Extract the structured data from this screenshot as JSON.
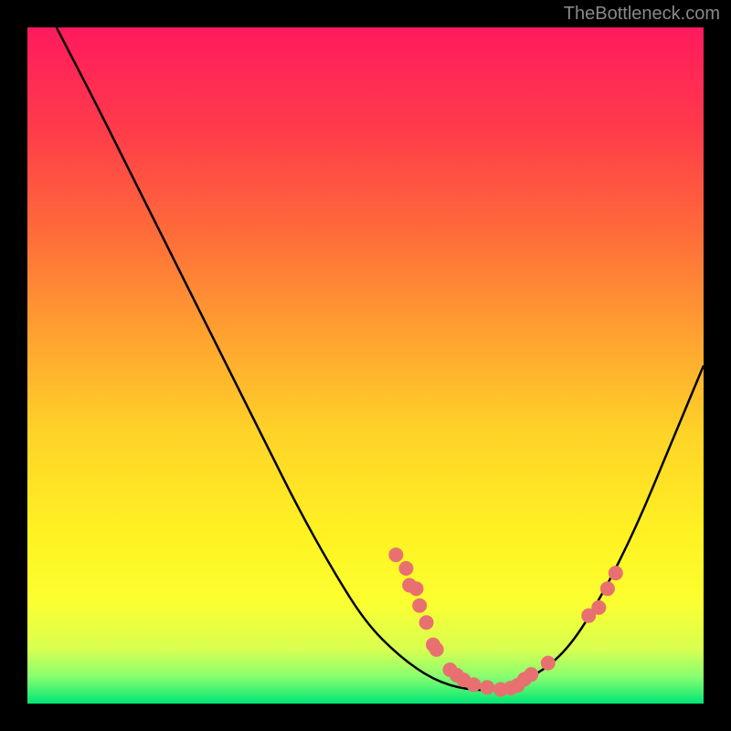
{
  "watermark": "TheBottleneck.com",
  "chart_data": {
    "type": "line",
    "title": "",
    "xlabel": "",
    "ylabel": "",
    "curve": {
      "description": "V-shaped bottleneck curve descending steeply then rising",
      "points_normalized": [
        [
          0.043,
          0.0
        ],
        [
          0.1,
          0.11
        ],
        [
          0.15,
          0.21
        ],
        [
          0.2,
          0.31
        ],
        [
          0.25,
          0.41
        ],
        [
          0.3,
          0.51
        ],
        [
          0.35,
          0.61
        ],
        [
          0.4,
          0.71
        ],
        [
          0.45,
          0.8
        ],
        [
          0.5,
          0.88
        ],
        [
          0.55,
          0.93
        ],
        [
          0.6,
          0.965
        ],
        [
          0.65,
          0.98
        ],
        [
          0.7,
          0.98
        ],
        [
          0.75,
          0.96
        ],
        [
          0.8,
          0.92
        ],
        [
          0.85,
          0.84
        ],
        [
          0.9,
          0.74
        ],
        [
          0.95,
          0.62
        ],
        [
          1.0,
          0.5
        ]
      ]
    },
    "scatter_points": {
      "description": "highlighted points near curve minimum region",
      "clusters": [
        {
          "x_norm": 0.545,
          "y_norm": 0.78
        },
        {
          "x_norm": 0.56,
          "y_norm": 0.8
        },
        {
          "x_norm": 0.565,
          "y_norm": 0.825
        },
        {
          "x_norm": 0.575,
          "y_norm": 0.83
        },
        {
          "x_norm": 0.58,
          "y_norm": 0.855
        },
        {
          "x_norm": 0.59,
          "y_norm": 0.88
        },
        {
          "x_norm": 0.6,
          "y_norm": 0.913
        },
        {
          "x_norm": 0.605,
          "y_norm": 0.92
        },
        {
          "x_norm": 0.625,
          "y_norm": 0.95
        },
        {
          "x_norm": 0.635,
          "y_norm": 0.958
        },
        {
          "x_norm": 0.645,
          "y_norm": 0.965
        },
        {
          "x_norm": 0.66,
          "y_norm": 0.972
        },
        {
          "x_norm": 0.68,
          "y_norm": 0.976
        },
        {
          "x_norm": 0.7,
          "y_norm": 0.979
        },
        {
          "x_norm": 0.715,
          "y_norm": 0.977
        },
        {
          "x_norm": 0.725,
          "y_norm": 0.973
        },
        {
          "x_norm": 0.735,
          "y_norm": 0.964
        },
        {
          "x_norm": 0.745,
          "y_norm": 0.957
        },
        {
          "x_norm": 0.77,
          "y_norm": 0.94
        },
        {
          "x_norm": 0.83,
          "y_norm": 0.87
        },
        {
          "x_norm": 0.845,
          "y_norm": 0.858
        },
        {
          "x_norm": 0.858,
          "y_norm": 0.83
        },
        {
          "x_norm": 0.87,
          "y_norm": 0.807
        }
      ]
    },
    "gradient_stops": [
      {
        "offset": 0.0,
        "color": "#ff1a5e"
      },
      {
        "offset": 0.15,
        "color": "#ff3b4a"
      },
      {
        "offset": 0.3,
        "color": "#ff6a3a"
      },
      {
        "offset": 0.45,
        "color": "#ffa030"
      },
      {
        "offset": 0.6,
        "color": "#ffd328"
      },
      {
        "offset": 0.75,
        "color": "#fff222"
      },
      {
        "offset": 0.85,
        "color": "#fbff30"
      },
      {
        "offset": 0.92,
        "color": "#d8ff50"
      },
      {
        "offset": 0.96,
        "color": "#88ff70"
      },
      {
        "offset": 1.0,
        "color": "#00e676"
      }
    ],
    "point_radius": 8
  }
}
